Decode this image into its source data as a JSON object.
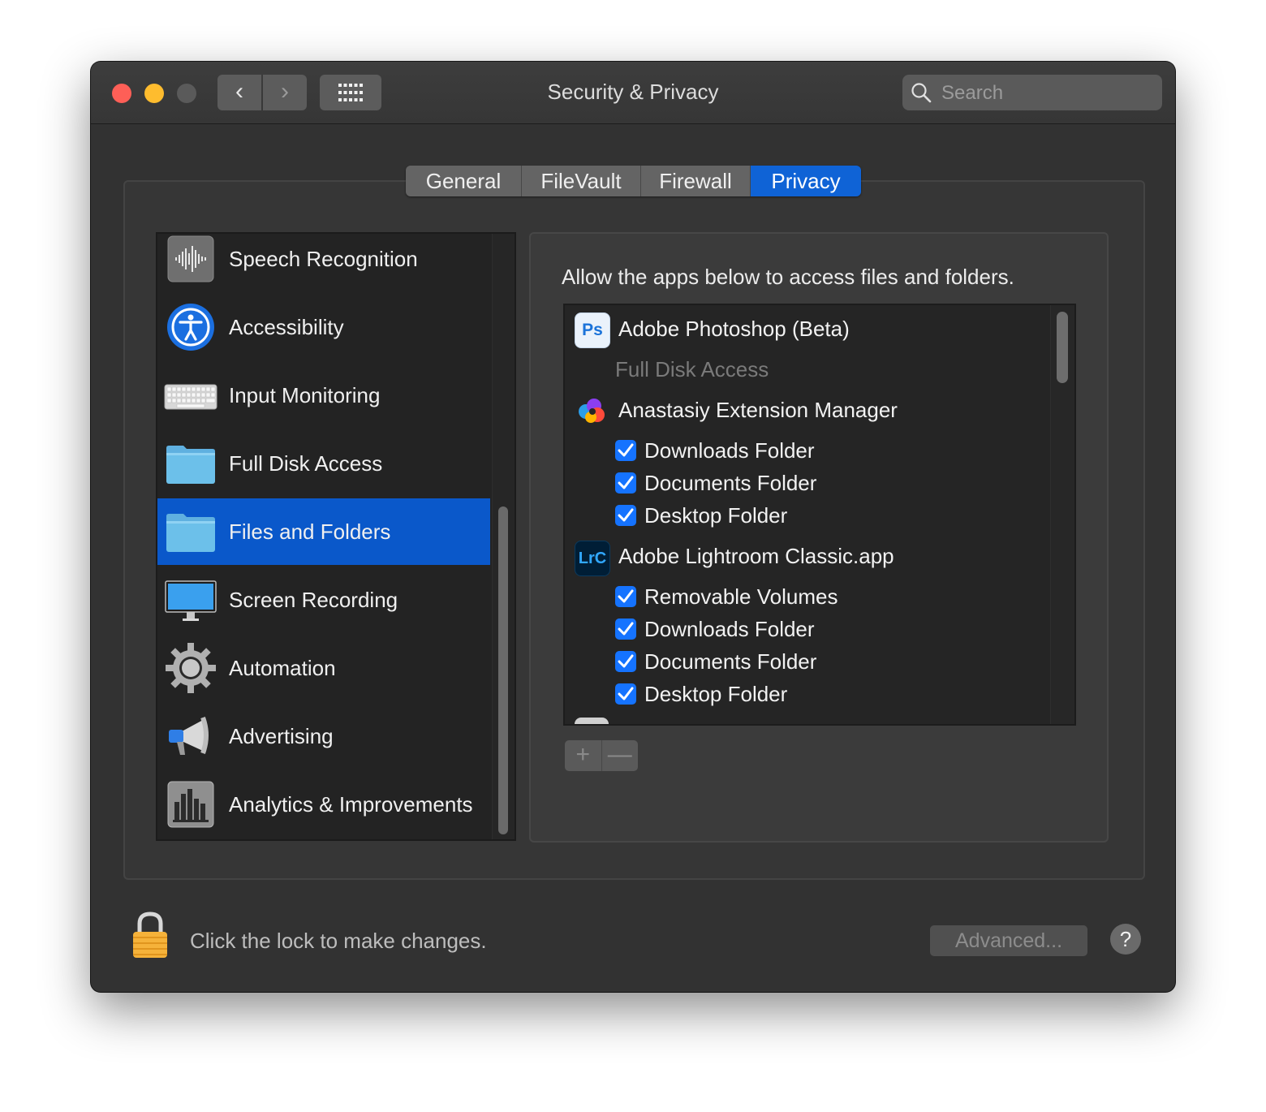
{
  "window": {
    "title": "Security & Privacy"
  },
  "toolbar": {
    "back_glyph": "‹",
    "forward_glyph": "›",
    "grid_icon": "grid-icon"
  },
  "search": {
    "placeholder": "Search"
  },
  "tabs": [
    {
      "label": "General"
    },
    {
      "label": "FileVault"
    },
    {
      "label": "Firewall"
    },
    {
      "label": "Privacy",
      "active": true
    }
  ],
  "sidebar": {
    "items": [
      {
        "label": "Speech Recognition",
        "icon": "waveform-icon"
      },
      {
        "label": "Accessibility",
        "icon": "accessibility-icon"
      },
      {
        "label": "Input Monitoring",
        "icon": "keyboard-icon"
      },
      {
        "label": "Full Disk Access",
        "icon": "folder-icon"
      },
      {
        "label": "Files and Folders",
        "icon": "folder-icon",
        "selected": true
      },
      {
        "label": "Screen Recording",
        "icon": "display-icon"
      },
      {
        "label": "Automation",
        "icon": "gear-icon"
      },
      {
        "label": "Advertising",
        "icon": "megaphone-icon"
      },
      {
        "label": "Analytics & Improvements",
        "icon": "bar-chart-icon"
      }
    ]
  },
  "detail": {
    "title": "Allow the apps below to access files and folders.",
    "apps": [
      {
        "name": "Adobe Photoshop (Beta)",
        "icon_text": "Ps",
        "sub_note": "Full Disk Access",
        "items": []
      },
      {
        "name": "Anastasiy Extension Manager",
        "icon_text": "",
        "items": [
          {
            "label": "Downloads Folder",
            "checked": true
          },
          {
            "label": "Documents Folder",
            "checked": true
          },
          {
            "label": "Desktop Folder",
            "checked": true
          }
        ]
      },
      {
        "name": "Adobe Lightroom Classic.app",
        "icon_text": "LrC",
        "items": [
          {
            "label": "Removable Volumes",
            "checked": true
          },
          {
            "label": "Downloads Folder",
            "checked": true
          },
          {
            "label": "Documents Folder",
            "checked": true
          },
          {
            "label": "Desktop Folder",
            "checked": true
          }
        ]
      }
    ],
    "add_label": "+",
    "remove_label": "—"
  },
  "footer": {
    "lock_text": "Click the lock to make changes.",
    "advanced_label": "Advanced...",
    "help_label": "?"
  },
  "colors": {
    "accent": "#0f63d6",
    "checkbox": "#1573ff",
    "close": "#fe5f57",
    "minimize": "#febc2e"
  }
}
